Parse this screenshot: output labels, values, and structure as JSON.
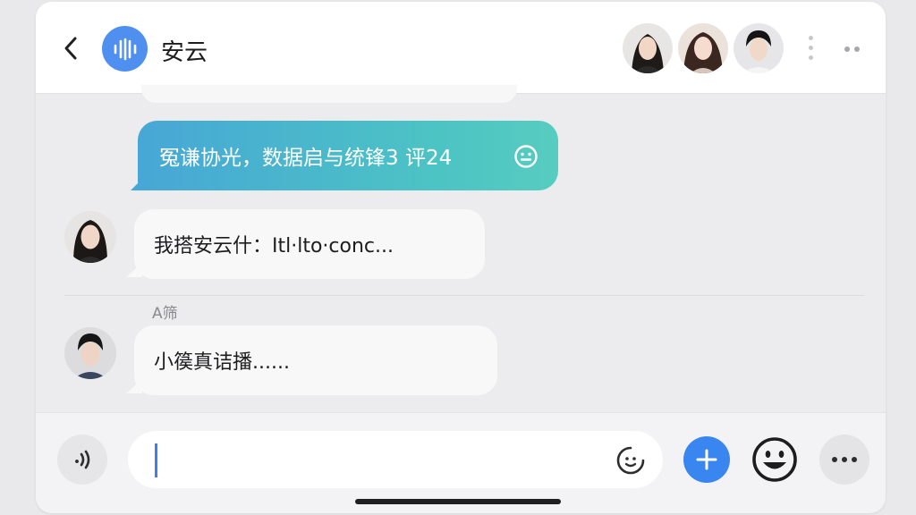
{
  "header": {
    "title": "安云",
    "back_icon": "chevron-left-icon",
    "group_icon": "soundwave-icon",
    "accent_color": "#4f8ff0",
    "member_count_shown": 3
  },
  "messages": {
    "outgoing": {
      "text": "冤谦协光，数据启与统锋3 评24",
      "icon": "smiley-icon"
    },
    "incoming_1": {
      "text": "我搭安云什：Itl·lto·conc..."
    },
    "incoming_2": {
      "sender_name": "A筛",
      "text": "小篌真诘播......"
    }
  },
  "composer": {
    "input_value": "",
    "voice_icon": "voice-icon",
    "sticker_icon": "sticker-icon",
    "plus_icon": "plus-icon",
    "emoji_icon": "emoji-icon",
    "more_icon": "more-icon",
    "plus_color": "#3a86f0"
  }
}
